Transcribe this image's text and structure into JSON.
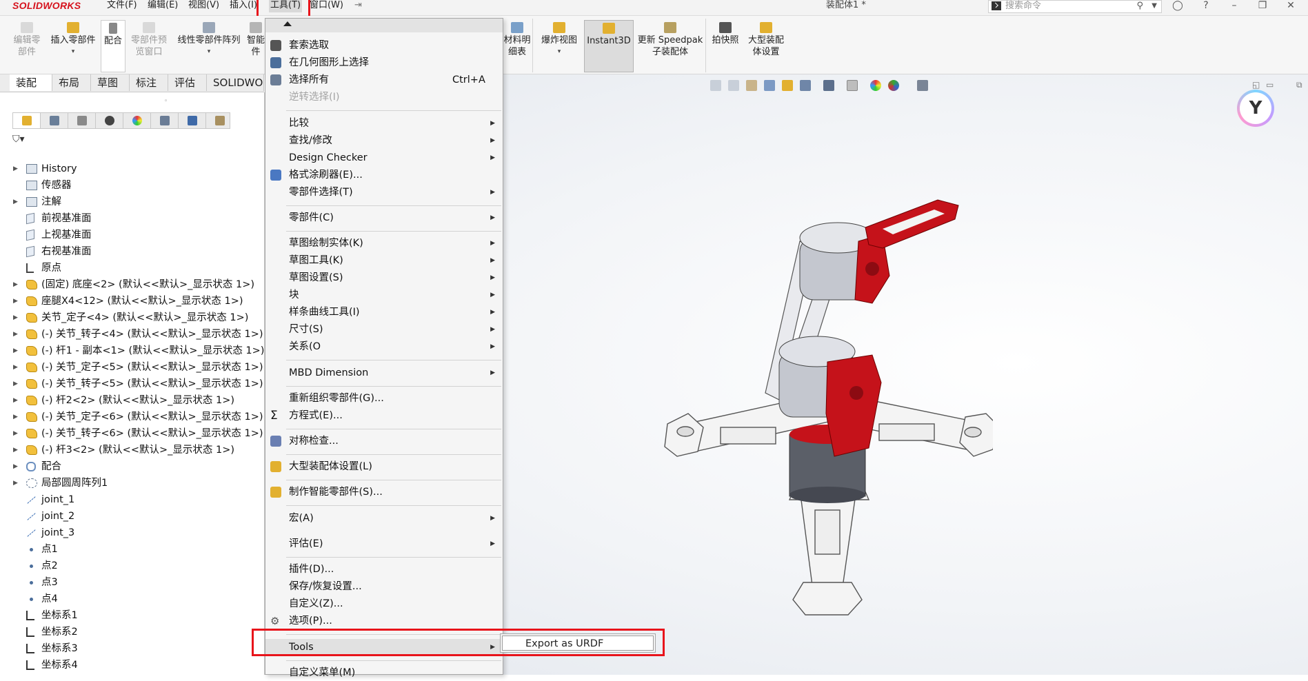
{
  "app": {
    "brand": "SOLIDWORKS",
    "document_title": "装配体1 *",
    "search_placeholder": "搜索命令"
  },
  "menubar": {
    "items": [
      "文件(F)",
      "编辑(E)",
      "视图(V)",
      "插入(I)",
      "工具(T)",
      "窗口(W)"
    ]
  },
  "ribbon": {
    "buttons": [
      {
        "label": "编辑零\n部件",
        "icon": "edit-component-icon",
        "enabled": false
      },
      {
        "label": "插入零部件",
        "icon": "insert-component-icon",
        "enabled": true
      },
      {
        "label": "配合",
        "icon": "mate-icon",
        "enabled": true
      },
      {
        "label": "零部件预\n览窗口",
        "icon": "component-preview-icon",
        "enabled": false
      },
      {
        "label": "线性零部件阵列",
        "icon": "linear-pattern-icon",
        "enabled": true
      },
      {
        "label": "智能\n件",
        "icon": "smart-fastener-icon",
        "enabled": true
      },
      {
        "label": "材料明\n细表",
        "icon": "bom-icon",
        "enabled": true
      },
      {
        "label": "爆炸视图",
        "icon": "exploded-view-icon",
        "enabled": true
      },
      {
        "label": "Instant3D",
        "icon": "instant3d-icon",
        "enabled": true
      },
      {
        "label": "更新 Speedpak\n子装配体",
        "icon": "speedpak-icon",
        "enabled": true
      },
      {
        "label": "拍快照",
        "icon": "snapshot-icon",
        "enabled": true
      },
      {
        "label": "大型装配\n体设置",
        "icon": "large-assembly-icon",
        "enabled": true
      }
    ]
  },
  "command_tabs": [
    "装配体",
    "布局",
    "草图",
    "标注",
    "评估",
    "SOLIDWOR"
  ],
  "feature_tree": [
    {
      "label": "History",
      "icon": "folder",
      "expand": true
    },
    {
      "label": "传感器",
      "icon": "folder",
      "expand": false
    },
    {
      "label": "注解",
      "icon": "folder",
      "expand": true
    },
    {
      "label": "前视基准面",
      "icon": "plane",
      "expand": false
    },
    {
      "label": "上视基准面",
      "icon": "plane",
      "expand": false
    },
    {
      "label": "右视基准面",
      "icon": "plane",
      "expand": false
    },
    {
      "label": "原点",
      "icon": "origin",
      "expand": false
    },
    {
      "label": "(固定) 底座<2> (默认<<默认>_显示状态 1>)",
      "icon": "part",
      "expand": true
    },
    {
      "label": "座腿X4<12> (默认<<默认>_显示状态 1>)",
      "icon": "part",
      "expand": true
    },
    {
      "label": "关节_定子<4> (默认<<默认>_显示状态 1>)",
      "icon": "part",
      "expand": true
    },
    {
      "label": "(-) 关节_转子<4> (默认<<默认>_显示状态 1>)",
      "icon": "part",
      "expand": true
    },
    {
      "label": "(-) 杆1 - 副本<1> (默认<<默认>_显示状态 1>)",
      "icon": "part",
      "expand": true
    },
    {
      "label": "(-) 关节_定子<5> (默认<<默认>_显示状态 1>)",
      "icon": "part",
      "expand": true
    },
    {
      "label": "(-) 关节_转子<5> (默认<<默认>_显示状态 1>)",
      "icon": "part",
      "expand": true
    },
    {
      "label": "(-) 杆2<2> (默认<<默认>_显示状态 1>)",
      "icon": "part",
      "expand": true
    },
    {
      "label": "(-) 关节_定子<6> (默认<<默认>_显示状态 1>)",
      "icon": "part",
      "expand": true
    },
    {
      "label": "(-) 关节_转子<6> (默认<<默认>_显示状态 1>)",
      "icon": "part",
      "expand": true
    },
    {
      "label": "(-) 杆3<2> (默认<<默认>_显示状态 1>)",
      "icon": "part",
      "expand": true
    },
    {
      "label": "配合",
      "icon": "mate",
      "expand": true
    },
    {
      "label": "局部圆周阵列1",
      "icon": "pattern",
      "expand": true
    },
    {
      "label": "joint_1",
      "icon": "axis",
      "expand": false
    },
    {
      "label": "joint_2",
      "icon": "axis",
      "expand": false
    },
    {
      "label": "joint_3",
      "icon": "axis",
      "expand": false
    },
    {
      "label": "点1",
      "icon": "point",
      "expand": false
    },
    {
      "label": "点2",
      "icon": "point",
      "expand": false
    },
    {
      "label": "点3",
      "icon": "point",
      "expand": false
    },
    {
      "label": "点4",
      "icon": "point",
      "expand": false
    },
    {
      "label": "坐标系1",
      "icon": "coord",
      "expand": false
    },
    {
      "label": "坐标系2",
      "icon": "coord",
      "expand": false
    },
    {
      "label": "坐标系3",
      "icon": "coord",
      "expand": false
    },
    {
      "label": "坐标系4",
      "icon": "coord",
      "expand": false
    }
  ],
  "tools_menu": {
    "items": [
      {
        "label": "套索选取",
        "icon": "lasso-icon"
      },
      {
        "label": "在几何图形上选择",
        "icon": "select-geometry-icon"
      },
      {
        "label": "选择所有",
        "shortcut": "Ctrl+A",
        "icon": "select-all-icon"
      },
      {
        "label": "逆转选择(I)",
        "disabled": true
      },
      {
        "label": "比较",
        "submenu": true
      },
      {
        "label": "查找/修改",
        "submenu": true
      },
      {
        "label": "Design Checker",
        "submenu": true
      },
      {
        "label": "格式涂刷器(E)...",
        "icon": "format-painter-icon"
      },
      {
        "label": "零部件选择(T)",
        "submenu": true
      },
      {
        "label": "零部件(C)",
        "submenu": true
      },
      {
        "label": "草图绘制实体(K)",
        "submenu": true
      },
      {
        "label": "草图工具(K)",
        "submenu": true
      },
      {
        "label": "草图设置(S)",
        "submenu": true
      },
      {
        "label": "块",
        "submenu": true
      },
      {
        "label": "样条曲线工具(I)",
        "submenu": true
      },
      {
        "label": "尺寸(S)",
        "submenu": true
      },
      {
        "label": "关系(O",
        "submenu": true
      },
      {
        "label": "MBD Dimension",
        "submenu": true
      },
      {
        "label": "重新组织零部件(G)..."
      },
      {
        "label": "方程式(E)...",
        "icon": "equation-icon"
      },
      {
        "label": "对称检查...",
        "icon": "symmetry-icon"
      },
      {
        "label": "大型装配体设置(L)",
        "icon": "large-assembly-icon"
      },
      {
        "label": "制作智能零部件(S)...",
        "icon": "smart-component-icon"
      },
      {
        "label": "宏(A)",
        "submenu": true
      },
      {
        "label": "评估(E)",
        "submenu": true
      },
      {
        "label": "插件(D)..."
      },
      {
        "label": "保存/恢复设置..."
      },
      {
        "label": "自定义(Z)..."
      },
      {
        "label": "选项(P)...",
        "icon": "gear-icon"
      },
      {
        "label": "Tools",
        "submenu": true
      },
      {
        "label": "自定义菜单(M)"
      }
    ],
    "submenu_item": "Export as URDF"
  },
  "colors": {
    "highlight_red": "#e8141b",
    "brand_red": "#d6121d",
    "part_red": "#c5121a",
    "part_grey": "#b9bcc4"
  }
}
